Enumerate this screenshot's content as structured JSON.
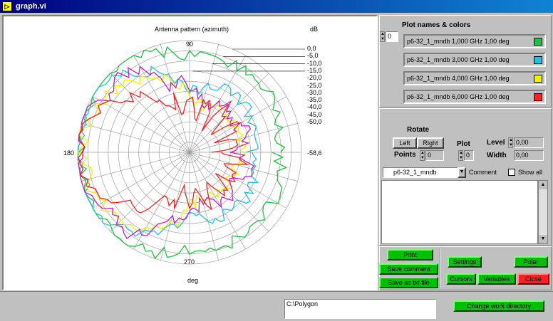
{
  "window": {
    "title": "graph.vi",
    "icon": "labview-vi-icon"
  },
  "graph": {
    "title": "Antenna pattern (azimuth)",
    "db_unit": "dB",
    "top_angle": "90",
    "left_angle": "180",
    "bottom_angle": "270",
    "axis_label": "deg",
    "db_scale": [
      "0,0",
      "-5,0",
      "-10,0",
      "-15,0",
      "-20,0",
      "-25,0",
      "-30,0",
      "-35,0",
      "-40,0",
      "-45,0",
      "-50,0"
    ],
    "db_min": "-58,6"
  },
  "plots": {
    "header": "Plot names & colors",
    "index": "0",
    "items": [
      {
        "label": "p6-32_1_mndb 1,000  GHz 1,00 deg",
        "color": "#20c040"
      },
      {
        "label": "p6-32_1_mndb 3,000  GHz 1,00 deg",
        "color": "#20c0e0"
      },
      {
        "label": "p6-32_1_mndb 4,000  GHz 1,00 deg",
        "color": "#f0f000"
      },
      {
        "label": "p6-32_1_mndb 6,000  GHz 1,00 deg",
        "color": "#ff2020"
      }
    ]
  },
  "controls": {
    "rotate_label": "Rotate",
    "left_btn": "Left",
    "right_btn": "Right",
    "points_label": "Points",
    "points_value": "0",
    "plot_label": "Plot",
    "plot_value": "0",
    "level_label": "Level",
    "level_value": "0,00",
    "width_label": "Width",
    "width_value": "0,00",
    "file_select": "p6-32_1_mndb",
    "comment_label": "Comment",
    "show_all_label": "Show all"
  },
  "buttons": {
    "print": "Print",
    "save_comment": "Save comment",
    "save_txt": "Save as txt file",
    "settings": "Settings",
    "polar": "Polar",
    "cursors": "Cursors",
    "variables": "Variables",
    "close": "Close",
    "change_dir": "Change work directory"
  },
  "path": {
    "value": "C:\\Polygon"
  },
  "colors": {
    "green": "#20c040",
    "cyan": "#20c0e0",
    "yellow": "#f0f000",
    "red": "#ff2020",
    "magenta": "#c020c0"
  }
}
